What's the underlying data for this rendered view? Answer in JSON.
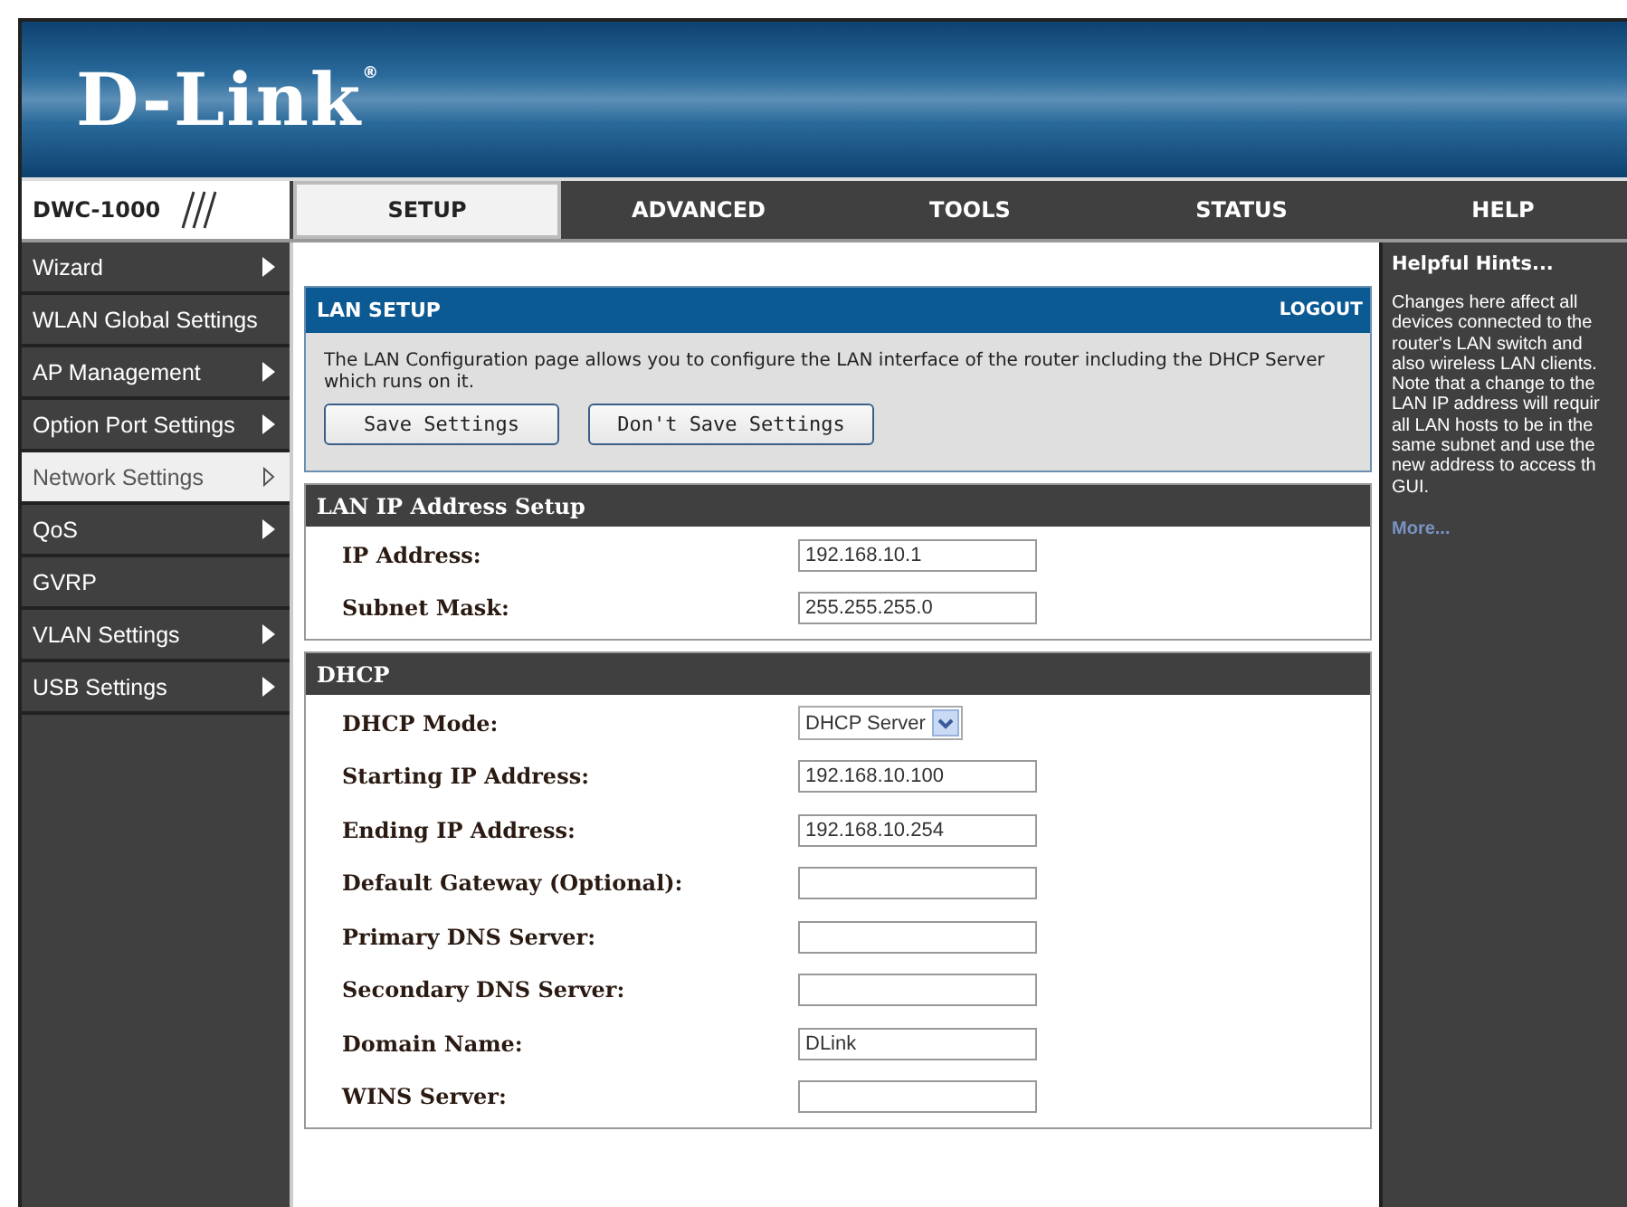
{
  "logo": "D-Link$^{®}$",
  "model": "DWC-1000",
  "tabs": [
    {
      "label": "SETUP",
      "selected": true
    },
    {
      "label": "ADVANCED",
      "selected": false
    },
    {
      "label": "TOOLS",
      "selected": false
    },
    {
      "label": "STATUS",
      "selected": false
    },
    {
      "label": "HELP",
      "selected": false
    }
  ],
  "sidebar": {
    "items": [
      {
        "label": "Wizard",
        "submenu": true,
        "selected": false
      },
      {
        "label": "WLAN Global Settings",
        "submenu": false,
        "selected": false
      },
      {
        "label": "AP Management",
        "submenu": true,
        "selected": false
      },
      {
        "label": "Option Port Settings",
        "submenu": true,
        "selected": false
      },
      {
        "label": "Network Settings",
        "submenu": true,
        "selected": true
      },
      {
        "label": "QoS",
        "submenu": true,
        "selected": false
      },
      {
        "label": "GVRP",
        "submenu": false,
        "selected": false
      },
      {
        "label": "VLAN Settings",
        "submenu": true,
        "selected": false
      },
      {
        "label": "USB Settings",
        "submenu": true,
        "selected": false
      }
    ]
  },
  "lan_setup": {
    "title": "LAN SETUP",
    "logout": "LOGOUT",
    "description": "The LAN Configuration page allows you to configure the LAN interface of the router including the DHCP Server which runs on it.",
    "buttons": [
      "Save Settings",
      "Don't Save Settings"
    ]
  },
  "sections": [
    {
      "title": "LAN IP Address Setup",
      "fields": [
        {
          "label": "IP Address:",
          "kind": "text",
          "value": "192.168.10.1"
        },
        {
          "label": "Subnet Mask:",
          "kind": "text",
          "value": "255.255.255.0"
        }
      ]
    },
    {
      "title": "DHCP",
      "fields": [
        {
          "label": "DHCP Mode:",
          "kind": "select",
          "value": "DHCP Server"
        },
        {
          "label": "Starting IP Address:",
          "kind": "text",
          "value": "192.168.10.100"
        },
        {
          "label": "Ending IP Address:",
          "kind": "text",
          "value": "192.168.10.254"
        },
        {
          "label": "Default Gateway (Optional):",
          "kind": "text"
        },
        {
          "label": "Primary DNS Server:",
          "kind": "text"
        },
        {
          "label": "Secondary DNS Server:",
          "kind": "text"
        },
        {
          "label": "Domain Name:",
          "kind": "text",
          "value": "DLink"
        },
        {
          "label": "WINS Server:",
          "kind": "text"
        }
      ]
    }
  ],
  "help": {
    "title": "Helpful Hints...",
    "lines": [
      "Changes here affect all",
      "devices connected to the",
      "router's LAN switch and",
      "also wireless LAN clients.",
      "Note that a change to the",
      "LAN IP address will requir",
      "all LAN hosts to be in the",
      "same subnet and use the",
      "new address to access th",
      "GUI."
    ],
    "more": "More..."
  }
}
